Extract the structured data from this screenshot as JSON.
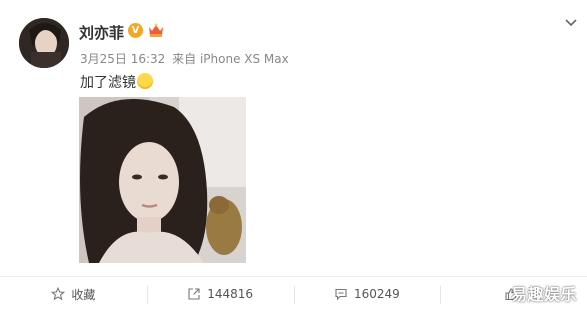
{
  "post": {
    "author": "刘亦菲",
    "verified_badge": "V",
    "date": "3月25日 16:32",
    "source": "来自 iPhone XS Max",
    "text": "加了滤镜"
  },
  "actions": {
    "favorite": {
      "label": "收藏",
      "icon": "star-icon"
    },
    "repost": {
      "label": "144816",
      "icon": "share-arrow-icon"
    },
    "comment": {
      "label": "160249",
      "icon": "comment-icon"
    },
    "like": {
      "label": "",
      "icon": "thumb-up-icon"
    }
  },
  "watermark": "易趣娱乐",
  "colors": {
    "badge": "#f5a623",
    "meta_text": "#888888",
    "divider": "#eeeeee"
  }
}
